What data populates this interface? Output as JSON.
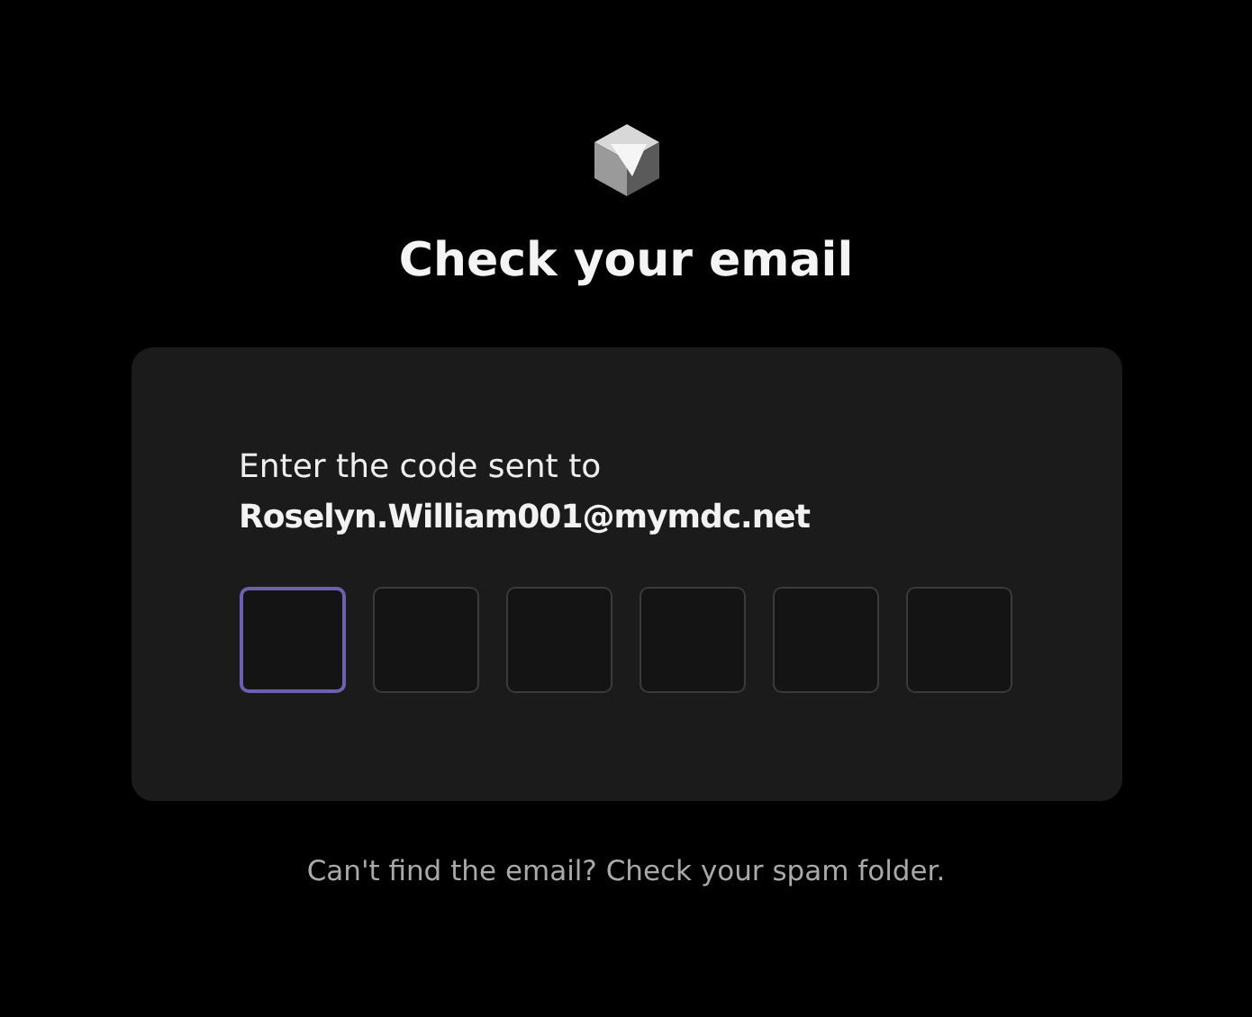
{
  "title": "Check your email",
  "card": {
    "prompt": "Enter the code sent to",
    "email": "Roselyn.William001@mymdc.net",
    "code_boxes": [
      {
        "focused": true
      },
      {
        "focused": false
      },
      {
        "focused": false
      },
      {
        "focused": false
      },
      {
        "focused": false
      },
      {
        "focused": false
      }
    ]
  },
  "footer": "Can't find the email? Check your spam folder."
}
